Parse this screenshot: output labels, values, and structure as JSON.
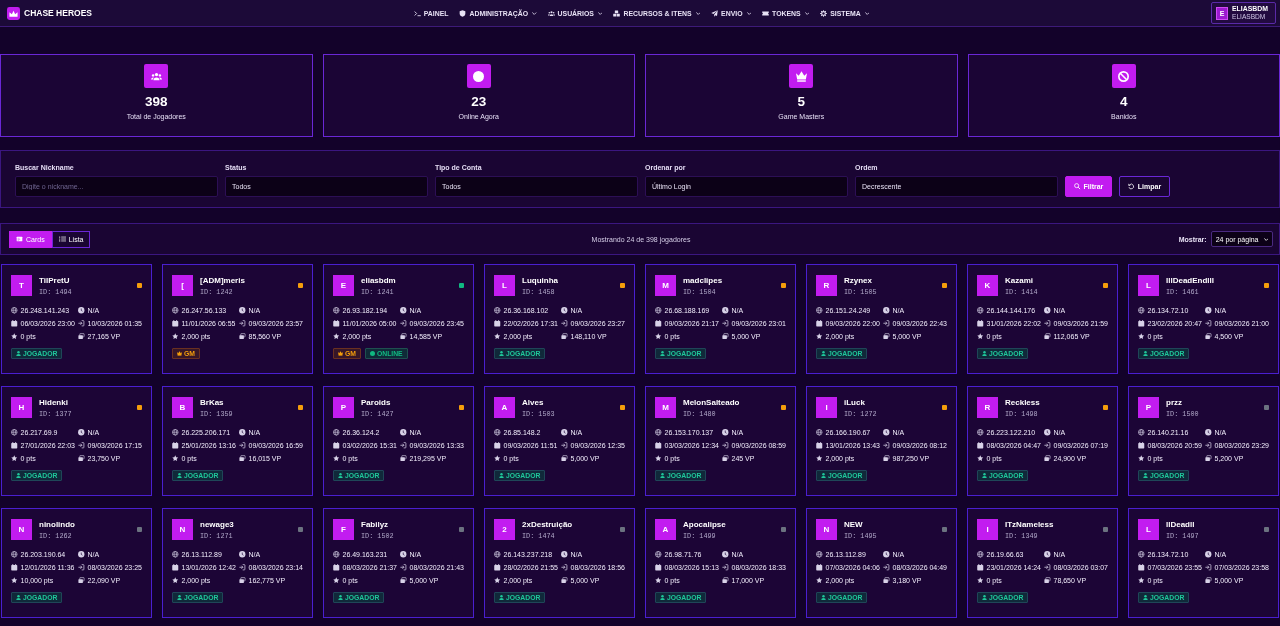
{
  "navbar": {
    "brand": "CHASE HEROES",
    "items": [
      {
        "label": "PAINEL",
        "dropdown": false
      },
      {
        "label": "ADMINISTRAÇÃO",
        "dropdown": true
      },
      {
        "label": "USUÁRIOS",
        "dropdown": true
      },
      {
        "label": "RECURSOS & ITENS",
        "dropdown": true
      },
      {
        "label": "ENVIO",
        "dropdown": true
      },
      {
        "label": "TOKENS",
        "dropdown": true
      },
      {
        "label": "SISTEMA",
        "dropdown": true
      }
    ],
    "user": {
      "initial": "E",
      "name": "ELIASBDM",
      "username": "ELIASBDM"
    }
  },
  "stats": [
    {
      "value": "398",
      "label": "Total de Jogadores"
    },
    {
      "value": "23",
      "label": "Online Agora"
    },
    {
      "value": "5",
      "label": "Game Masters"
    },
    {
      "value": "4",
      "label": "Banidos"
    }
  ],
  "filters": {
    "fields": [
      {
        "label": "Buscar Nickname",
        "kind": "text",
        "placeholder": "Digite o nickname..."
      },
      {
        "label": "Status",
        "kind": "select",
        "value": "Todos"
      },
      {
        "label": "Tipo de Conta",
        "kind": "select",
        "value": "Todos"
      },
      {
        "label": "Ordenar por",
        "kind": "select",
        "value": "Último Login"
      },
      {
        "label": "Ordem",
        "kind": "select",
        "value": "Decrescente"
      }
    ],
    "buttons": [
      {
        "label": "Filtrar",
        "kind": "primary"
      },
      {
        "label": "Limpar",
        "kind": "secondary"
      }
    ]
  },
  "toolbar": {
    "view_toggle": [
      {
        "label": "Cards",
        "selected": true
      },
      {
        "label": "Lista",
        "selected": false
      }
    ],
    "summary": "Mostrando 24 de 398 jogadores",
    "per_page": {
      "label": "Mostrar:",
      "value": "24 por página"
    }
  },
  "cards": [
    {
      "initial": "T",
      "name": "TilPretU",
      "id": "ID: 1494",
      "color": "#f59e0b",
      "ip": "26.248.141.243",
      "time": "N/A",
      "created": "06/03/2026 23:00",
      "last_login": "10/03/2026 01:35",
      "points": "0 pts",
      "vp": "27,165 VP",
      "badges": [
        {
          "kind": "player",
          "label": "JOGADOR"
        }
      ]
    },
    {
      "initial": "[",
      "name": "[ADM]meris",
      "id": "ID: 1242",
      "color": "#f59e0b",
      "ip": "26.247.56.133",
      "time": "N/A",
      "created": "11/01/2026 06:55",
      "last_login": "09/03/2026 23:57",
      "points": "2,000 pts",
      "vp": "85,560 VP",
      "badges": [
        {
          "kind": "gm",
          "label": "GM"
        }
      ]
    },
    {
      "initial": "E",
      "name": "eliasbdm",
      "id": "ID: 1241",
      "color": "#10b981",
      "ip": "26.93.182.194",
      "time": "N/A",
      "created": "11/01/2026 05:00",
      "last_login": "09/03/2026 23:45",
      "points": "2,000 pts",
      "vp": "14,585 VP",
      "badges": [
        {
          "kind": "gm",
          "label": "GM"
        },
        {
          "kind": "online",
          "label": "ONLINE"
        }
      ]
    },
    {
      "initial": "L",
      "name": "Luquinha",
      "id": "ID: 1458",
      "color": "#f59e0b",
      "ip": "26.36.168.102",
      "time": "N/A",
      "created": "22/02/2026 17:31",
      "last_login": "09/03/2026 23:27",
      "points": "2,000 pts",
      "vp": "148,110 VP",
      "badges": [
        {
          "kind": "player",
          "label": "JOGADOR"
        }
      ]
    },
    {
      "initial": "M",
      "name": "madclipes",
      "id": "ID: 1504",
      "color": "#f59e0b",
      "ip": "26.68.188.169",
      "time": "N/A",
      "created": "09/03/2026 21:17",
      "last_login": "09/03/2026 23:01",
      "points": "0 pts",
      "vp": "5,000 VP",
      "badges": [
        {
          "kind": "player",
          "label": "JOGADOR"
        }
      ]
    },
    {
      "initial": "R",
      "name": "Rzynex",
      "id": "ID: 1505",
      "color": "#f59e0b",
      "ip": "26.151.24.249",
      "time": "N/A",
      "created": "09/03/2026 22:00",
      "last_login": "09/03/2026 22:43",
      "points": "2,000 pts",
      "vp": "5,000 VP",
      "badges": [
        {
          "kind": "player",
          "label": "JOGADOR"
        }
      ]
    },
    {
      "initial": "K",
      "name": "Kazami",
      "id": "ID: 1414",
      "color": "#f59e0b",
      "ip": "26.144.144.176",
      "time": "N/A",
      "created": "31/01/2026 22:02",
      "last_login": "09/03/2026 21:59",
      "points": "0 pts",
      "vp": "112,065 VP",
      "badges": [
        {
          "kind": "player",
          "label": "JOGADOR"
        }
      ]
    },
    {
      "initial": "L",
      "name": "lllDeadEndlll",
      "id": "ID: 1461",
      "color": "#f59e0b",
      "ip": "26.134.72.10",
      "time": "N/A",
      "created": "23/02/2026 20:47",
      "last_login": "09/03/2026 21:00",
      "points": "0 pts",
      "vp": "4,500 VP",
      "badges": [
        {
          "kind": "player",
          "label": "JOGADOR"
        }
      ]
    },
    {
      "initial": "H",
      "name": "Hidenki",
      "id": "ID: 1377",
      "color": "#f59e0b",
      "ip": "26.217.69.9",
      "time": "N/A",
      "created": "27/01/2026 22:03",
      "last_login": "09/03/2026 17:15",
      "points": "0 pts",
      "vp": "23,750 VP",
      "badges": [
        {
          "kind": "player",
          "label": "JOGADOR"
        }
      ]
    },
    {
      "initial": "B",
      "name": "BrKas",
      "id": "ID: 1359",
      "color": "#f59e0b",
      "ip": "26.225.206.171",
      "time": "N/A",
      "created": "25/01/2026 13:16",
      "last_login": "09/03/2026 16:59",
      "points": "0 pts",
      "vp": "16,015 VP",
      "badges": [
        {
          "kind": "player",
          "label": "JOGADOR"
        }
      ]
    },
    {
      "initial": "P",
      "name": "Paroids",
      "id": "ID: 1427",
      "color": "#f59e0b",
      "ip": "26.36.124.2",
      "time": "N/A",
      "created": "03/02/2026 15:31",
      "last_login": "09/03/2026 13:33",
      "points": "0 pts",
      "vp": "219,295 VP",
      "badges": [
        {
          "kind": "player",
          "label": "JOGADOR"
        }
      ]
    },
    {
      "initial": "A",
      "name": "Alves",
      "id": "ID: 1503",
      "color": "#f59e0b",
      "ip": "26.85.148.2",
      "time": "N/A",
      "created": "09/03/2026 11:51",
      "last_login": "09/03/2026 12:35",
      "points": "0 pts",
      "vp": "5,000 VP",
      "badges": [
        {
          "kind": "player",
          "label": "JOGADOR"
        }
      ]
    },
    {
      "initial": "M",
      "name": "MelonSalteado",
      "id": "ID: 1480",
      "color": "#f59e0b",
      "ip": "26.153.170.137",
      "time": "N/A",
      "created": "03/03/2026 12:34",
      "last_login": "09/03/2026 08:59",
      "points": "0 pts",
      "vp": "245 VP",
      "badges": [
        {
          "kind": "player",
          "label": "JOGADOR"
        }
      ]
    },
    {
      "initial": "I",
      "name": "iLuck",
      "id": "ID: 1272",
      "color": "#f59e0b",
      "ip": "26.166.190.67",
      "time": "N/A",
      "created": "13/01/2026 13:43",
      "last_login": "09/03/2026 08:12",
      "points": "2,000 pts",
      "vp": "987,250 VP",
      "badges": [
        {
          "kind": "player",
          "label": "JOGADOR"
        }
      ]
    },
    {
      "initial": "R",
      "name": "Reckless",
      "id": "ID: 1498",
      "color": "#f59e0b",
      "ip": "26.223.122.210",
      "time": "N/A",
      "created": "08/03/2026 04:47",
      "last_login": "09/03/2026 07:19",
      "points": "0 pts",
      "vp": "24,900 VP",
      "badges": [
        {
          "kind": "player",
          "label": "JOGADOR"
        }
      ]
    },
    {
      "initial": "P",
      "name": "przz",
      "id": "ID: 1500",
      "color": "#6b7280",
      "ip": "26.140.21.16",
      "time": "N/A",
      "created": "08/03/2026 20:59",
      "last_login": "08/03/2026 23:29",
      "points": "0 pts",
      "vp": "5,200 VP",
      "badges": [
        {
          "kind": "player",
          "label": "JOGADOR"
        }
      ]
    },
    {
      "initial": "N",
      "name": "ninolindo",
      "id": "ID: 1262",
      "color": "#6b7280",
      "ip": "26.203.190.64",
      "time": "N/A",
      "created": "12/01/2026 11:36",
      "last_login": "08/03/2026 23:25",
      "points": "10,000 pts",
      "vp": "22,090 VP",
      "badges": [
        {
          "kind": "player",
          "label": "JOGADOR"
        }
      ]
    },
    {
      "initial": "N",
      "name": "newage3",
      "id": "ID: 1271",
      "color": "#6b7280",
      "ip": "26.13.112.89",
      "time": "N/A",
      "created": "13/01/2026 12:42",
      "last_login": "08/03/2026 23:14",
      "points": "2,000 pts",
      "vp": "162,775 VP",
      "badges": [
        {
          "kind": "player",
          "label": "JOGADOR"
        }
      ]
    },
    {
      "initial": "F",
      "name": "Fabilyz",
      "id": "ID: 1502",
      "color": "#6b7280",
      "ip": "26.49.163.231",
      "time": "N/A",
      "created": "08/03/2026 21:37",
      "last_login": "08/03/2026 21:43",
      "points": "0 pts",
      "vp": "5,000 VP",
      "badges": [
        {
          "kind": "player",
          "label": "JOGADOR"
        }
      ]
    },
    {
      "initial": "2",
      "name": "2xDestruição",
      "id": "ID: 1474",
      "color": "#6b7280",
      "ip": "26.143.237.218",
      "time": "N/A",
      "created": "28/02/2026 21:55",
      "last_login": "08/03/2026 18:56",
      "points": "2,000 pts",
      "vp": "5,000 VP",
      "badges": [
        {
          "kind": "player",
          "label": "JOGADOR"
        }
      ]
    },
    {
      "initial": "A",
      "name": "Apocalipse",
      "id": "ID: 1499",
      "color": "#6b7280",
      "ip": "26.98.71.76",
      "time": "N/A",
      "created": "08/03/2026 15:13",
      "last_login": "08/03/2026 18:33",
      "points": "0 pts",
      "vp": "17,000 VP",
      "badges": [
        {
          "kind": "player",
          "label": "JOGADOR"
        }
      ]
    },
    {
      "initial": "N",
      "name": "NEW",
      "id": "ID: 1495",
      "color": "#6b7280",
      "ip": "26.13.112.89",
      "time": "N/A",
      "created": "07/03/2026 04:06",
      "last_login": "08/03/2026 04:49",
      "points": "2,000 pts",
      "vp": "3,180 VP",
      "badges": [
        {
          "kind": "player",
          "label": "JOGADOR"
        }
      ]
    },
    {
      "initial": "I",
      "name": "ITzNameless",
      "id": "ID: 1349",
      "color": "#6b7280",
      "ip": "26.19.66.63",
      "time": "N/A",
      "created": "23/01/2026 14:24",
      "last_login": "08/03/2026 03:07",
      "points": "0 pts",
      "vp": "78,650 VP",
      "badges": [
        {
          "kind": "player",
          "label": "JOGADOR"
        }
      ]
    },
    {
      "initial": "L",
      "name": "llDeadll",
      "id": "ID: 1497",
      "color": "#6b7280",
      "ip": "26.134.72.10",
      "time": "N/A",
      "created": "07/03/2026 23:55",
      "last_login": "07/03/2026 23:58",
      "points": "0 pts",
      "vp": "5,000 VP",
      "badges": [
        {
          "kind": "player",
          "label": "JOGADOR"
        }
      ]
    }
  ]
}
